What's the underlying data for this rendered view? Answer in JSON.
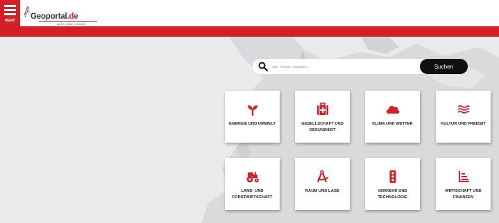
{
  "header": {
    "menu_label": "MENÜ",
    "logo_name": "Geoportal",
    "logo_tld": ".de",
    "logo_tagline": "suchen. finden. verbinden."
  },
  "search": {
    "placeholder": "Orte, Themen, Geodaten ...",
    "button_label": "Suchen"
  },
  "categories": [
    {
      "label": "Energie und Umwelt",
      "icon": "sprout-icon"
    },
    {
      "label": "Gesellschaft und Gesundheit",
      "icon": "first-aid-kit-icon"
    },
    {
      "label": "Klima und Wetter",
      "icon": "cloud-icon"
    },
    {
      "label": "Kultur und Freizeit",
      "icon": "waves-icon"
    },
    {
      "label": "Land- und Forstwirtschaft",
      "icon": "tractor-icon"
    },
    {
      "label": "Raum und Lage",
      "icon": "compass-icon"
    },
    {
      "label": "Verkehr und Technologie",
      "icon": "traffic-light-icon"
    },
    {
      "label": "Wirtschaft und Finanzen",
      "icon": "bar-chart-icon"
    }
  ],
  "colors": {
    "brand_red": "#d51f26",
    "map_background": "#e9eaeb",
    "land": "#d8d9da",
    "button_dark": "#111111"
  }
}
